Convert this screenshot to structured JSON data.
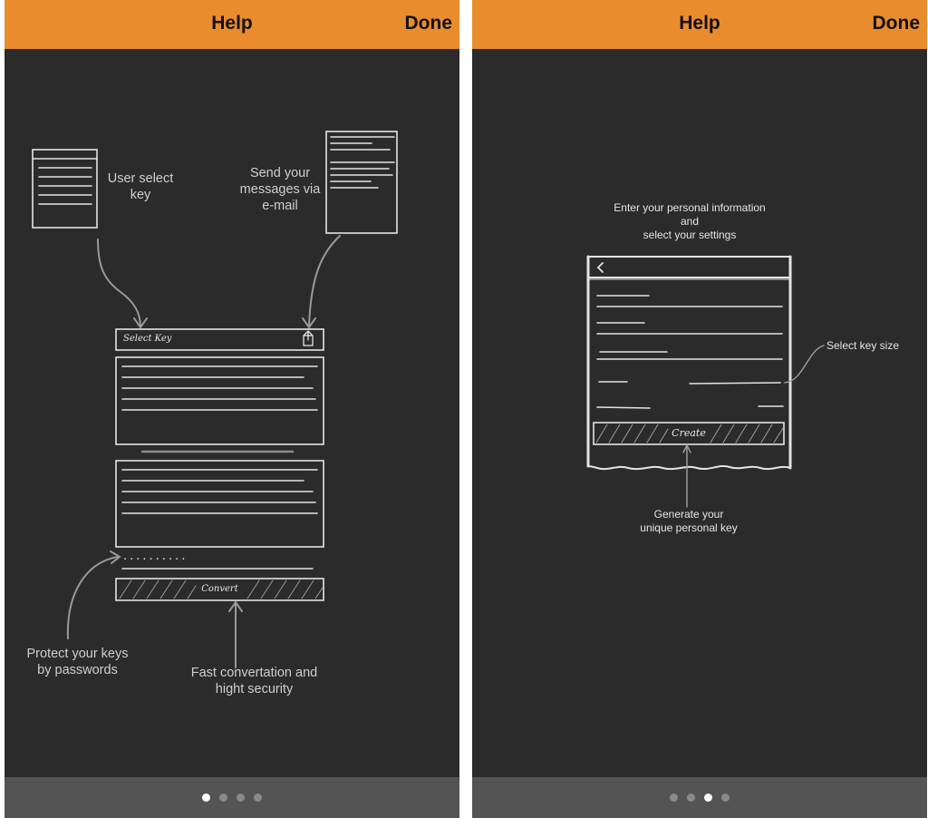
{
  "left": {
    "header": {
      "title": "Help",
      "done_label": "Done"
    },
    "captions": {
      "user_select_key": "User select\nkey",
      "send_messages": "Send your\nmessages via\ne-mail",
      "protect_keys": "Protect your keys\nby passwords",
      "fast_conversion": "Fast convertation and\nhight security"
    },
    "sketch": {
      "select_key_label": "Select Key",
      "convert_label": "Convert",
      "password_dots": "..........",
      "share_icon": "share-icon"
    },
    "pager": {
      "count": 4,
      "active": 0
    }
  },
  "right": {
    "header": {
      "title": "Help",
      "done_label": "Done"
    },
    "captions": {
      "enter_info": "Enter your personal information\nand\nselect your settings",
      "select_key_size": "Select key size",
      "generate_key": "Generate your\nunique personal key"
    },
    "sketch": {
      "create_label": "Create",
      "back_icon": "chevron-left-icon"
    },
    "pager": {
      "count": 4,
      "active": 2
    }
  },
  "colors": {
    "header": "#e98c2e",
    "background": "#2b2b2b",
    "footer": "#545454",
    "sketch_line": "#e4e4e4"
  }
}
